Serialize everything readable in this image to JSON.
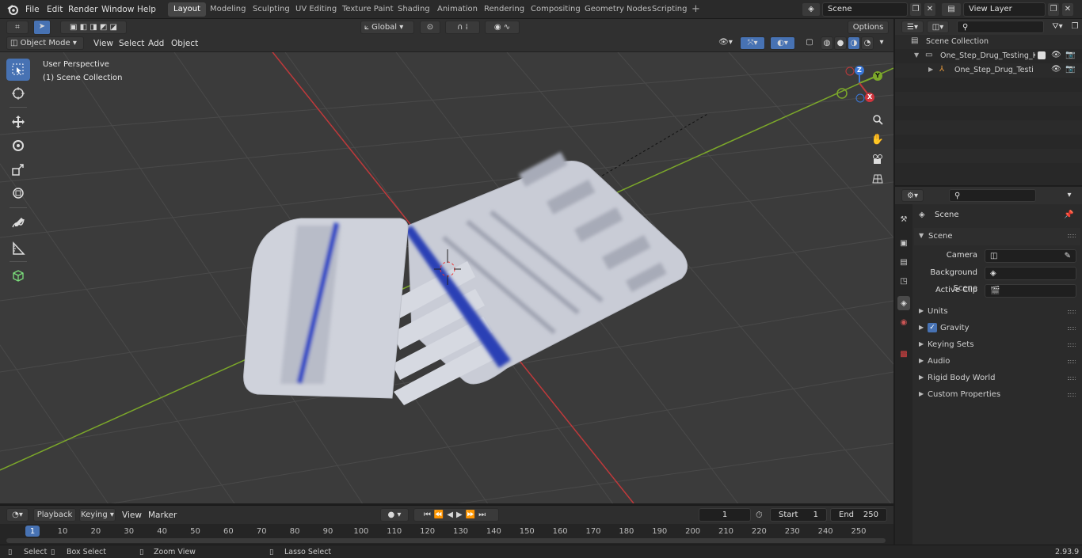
{
  "topbar": {
    "menus": [
      "File",
      "Edit",
      "Render",
      "Window",
      "Help"
    ],
    "workspace_tabs": [
      "Layout",
      "Modeling",
      "Sculpting",
      "UV Editing",
      "Texture Paint",
      "Shading",
      "Animation",
      "Rendering",
      "Compositing",
      "Geometry Nodes",
      "Scripting"
    ],
    "active_tab": "Layout",
    "scene_name": "Scene",
    "view_layer": "View Layer"
  },
  "viewport_header": {
    "mode": "Object Mode",
    "menus": [
      "View",
      "Select",
      "Add",
      "Object"
    ],
    "transform_orientation": "Global",
    "options_label": "Options"
  },
  "viewport": {
    "perspective_label": "User Perspective",
    "collection_label": "(1) Scene Collection",
    "gizmo_axes": [
      "Z",
      "Y",
      "X"
    ]
  },
  "outliner": {
    "root": "Scene Collection",
    "items": [
      {
        "label": "One_Step_Drug_Testing_Kit_C",
        "level": 1
      },
      {
        "label": "One_Step_Drug_Testing_",
        "level": 2
      }
    ]
  },
  "properties": {
    "context_title": "Scene",
    "section_title": "Scene",
    "fields": [
      {
        "label": "Camera",
        "value": ""
      },
      {
        "label": "Background Scene",
        "value": ""
      },
      {
        "label": "Active Clip",
        "value": ""
      }
    ],
    "panels": [
      "Units",
      "Gravity",
      "Keying Sets",
      "Audio",
      "Rigid Body World",
      "Custom Properties"
    ],
    "gravity_checked": true
  },
  "timeline": {
    "menus": [
      "Playback",
      "Keying",
      "View",
      "Marker"
    ],
    "current_frame": "1",
    "start_label": "Start",
    "start_value": "1",
    "end_label": "End",
    "end_value": "250",
    "ruler_ticks": [
      "1",
      "10",
      "20",
      "30",
      "40",
      "50",
      "60",
      "70",
      "80",
      "90",
      "100",
      "110",
      "120",
      "130",
      "140",
      "150",
      "160",
      "170",
      "180",
      "190",
      "200",
      "210",
      "220",
      "230",
      "240",
      "250"
    ]
  },
  "statusbar": {
    "items": [
      "Select",
      "Box Select",
      "Zoom View",
      "Lasso Select"
    ],
    "version": "2.93.9"
  },
  "colors": {
    "accent": "#4772b3",
    "x_axis": "#c0393b",
    "y_axis": "#7ca82a",
    "z_axis": "#3b78d8"
  }
}
